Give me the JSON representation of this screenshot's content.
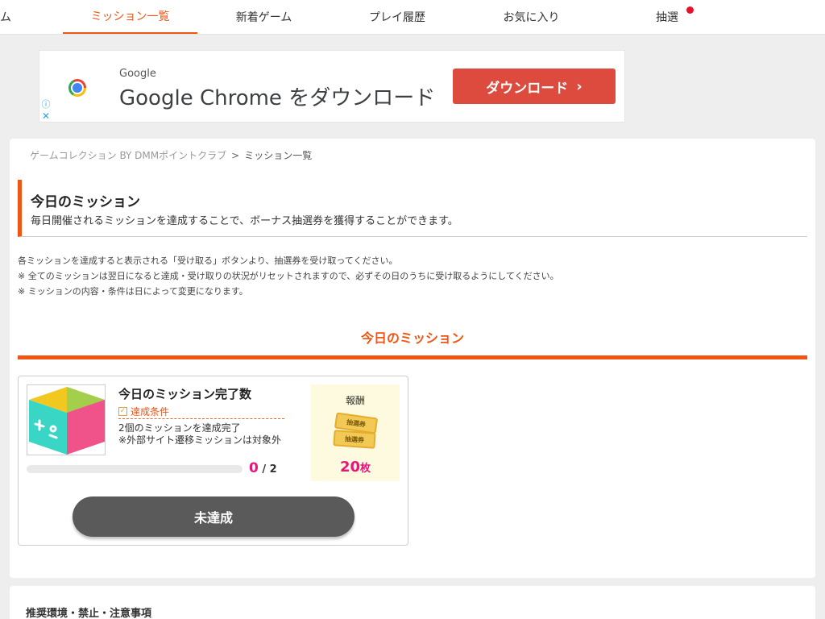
{
  "nav": {
    "items": [
      {
        "label": "ム"
      },
      {
        "label": "ミッション一覧",
        "active": true
      },
      {
        "label": "新着ゲーム"
      },
      {
        "label": "プレイ履歴"
      },
      {
        "label": "お気に入り"
      },
      {
        "label": "抽選",
        "badge_color": "#e8102a"
      }
    ]
  },
  "ad": {
    "brand": "Google",
    "headline": "Google Chrome をダウンロード",
    "button_label": "ダウンロード",
    "button_icon": "chevron-right-icon",
    "info_icon": "ⓘ",
    "close_icon": "✕"
  },
  "breadcrumb": {
    "parent": "ゲームコレクション BY DMMポイントクラブ",
    "separator": ">",
    "current": "ミッション一覧"
  },
  "heading": {
    "title": "今日のミッション",
    "description": "毎日開催されるミッションを達成することで、ボーナス抽選券を獲得することができます。"
  },
  "notes": [
    "各ミッションを達成すると表示される「受け取る」ボタンより、抽選券を受け取ってください。",
    "※ 全てのミッションは翌日になると達成・受け取りの状況がリセットされますので、必ずその日のうちに受け取るようにしてください。",
    "※ ミッションの内容・条件は日によって変更になります。"
  ],
  "section_title": "今日のミッション",
  "mission": {
    "title": "今日のミッション完了数",
    "condition_label": "達成条件",
    "condition_lines": [
      "2個のミッションを達成完了",
      "※外部サイト遷移ミッションは対象外"
    ],
    "progress_current": "0",
    "progress_total": "/ 2",
    "progress_fraction": 0,
    "reward_label": "報酬",
    "ticket_text": "抽選券",
    "reward_count": "20",
    "reward_unit": "枚",
    "status_label": "未達成"
  },
  "footer": {
    "title": "推奨環境・禁止・注意事項"
  },
  "colors": {
    "accent": "#f05514",
    "pink": "#e8157a",
    "status_button": "#5a5a5a",
    "ad_button": "#dd4b3e"
  }
}
